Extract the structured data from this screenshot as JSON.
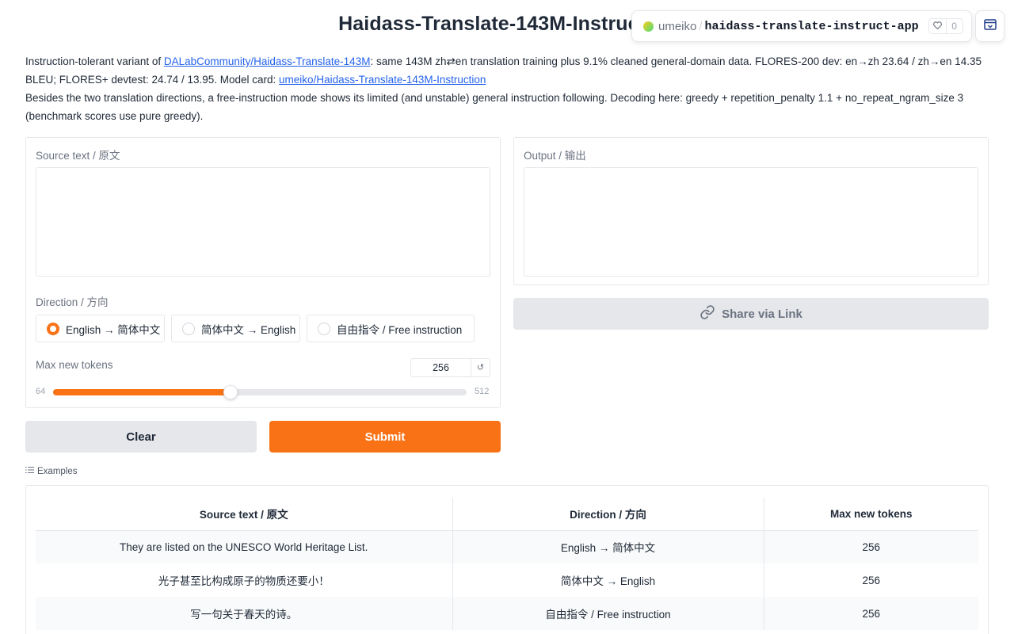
{
  "title": "Haidass-Translate-143M-Instruction",
  "badge": {
    "user": "umeiko",
    "separator": "/",
    "repo": "haidass-translate-instruct-app",
    "likes": "0"
  },
  "description": {
    "p1_prefix": "Instruction-tolerant variant of ",
    "p1_link": "DALabCommunity/Haidass-Translate-143M",
    "p1_mid": ": same 143M zh⇄en translation training plus 9.1% cleaned general-domain data. FLORES-200 dev: en→zh 23.64 / zh→en 14.35 BLEU; FLORES+ devtest: 24.74 / 13.95. Model card: ",
    "p1_link2": "umeiko/Haidass-Translate-143M-Instruction",
    "p2": "Besides the two translation directions, a free-instruction mode shows its limited (and unstable) general instruction following. Decoding here: greedy + repetition_penalty 1.1 + no_repeat_ngram_size 3 (benchmark scores use pure greedy)."
  },
  "source": {
    "label": "Source text / 原文",
    "value": ""
  },
  "direction": {
    "label": "Direction / 方向",
    "options": [
      "English → 简体中文",
      "简体中文 → English",
      "自由指令 / Free instruction"
    ],
    "selected_index": 0
  },
  "max_tokens": {
    "label": "Max new tokens",
    "value": "256",
    "min": "64",
    "max": "512",
    "fraction": 0.4286,
    "reset_glyph": "↺"
  },
  "output": {
    "label": "Output / 输出",
    "value": ""
  },
  "buttons": {
    "clear": "Clear",
    "submit": "Submit",
    "share": "Share via Link"
  },
  "examples": {
    "label": "Examples",
    "headers": [
      "Source text / 原文",
      "Direction / 方向",
      "Max new tokens"
    ],
    "rows": [
      [
        "They are listed on the UNESCO World Heritage List.",
        "English → 简体中文",
        "256"
      ],
      [
        "光子甚至比构成原子的物质还要小！",
        "简体中文 → English",
        "256"
      ],
      [
        "写一句关于春天的诗。",
        "自由指令 / Free instruction",
        "256"
      ]
    ]
  },
  "colors": {
    "accent": "#f97316",
    "link": "#2563eb",
    "border": "#e5e7eb"
  }
}
